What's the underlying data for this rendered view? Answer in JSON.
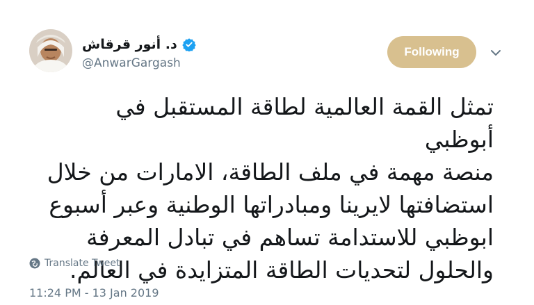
{
  "profile": {
    "display_name": "د. أنور قرقاش",
    "handle": "@AnwarGargash",
    "verified": true,
    "avatar_icon": "profile-photo"
  },
  "actions": {
    "follow_label": "Following",
    "follow_color": "#d8c08f",
    "caret_icon": "chevron-down-icon"
  },
  "tweet": {
    "text": "تمثل القمة العالمية لطاقة المستقبل في أبوظبي\nمنصة مهمة في ملف الطاقة، الامارات من خلال\nاستضافتها لايرينا ومبادراتها الوطنية وعبر أسبوع\nابوظبي للاستدامة تساهم في تبادل المعرفة\nوالحلول لتحديات الطاقة المتزايدة في العالم.",
    "translate_label": "Translate Tweet",
    "timestamp": "11:24 PM - 13 Jan 2019"
  },
  "colors": {
    "text_primary": "#14171a",
    "text_secondary": "#657786",
    "verified_blue": "#1da1f2"
  }
}
